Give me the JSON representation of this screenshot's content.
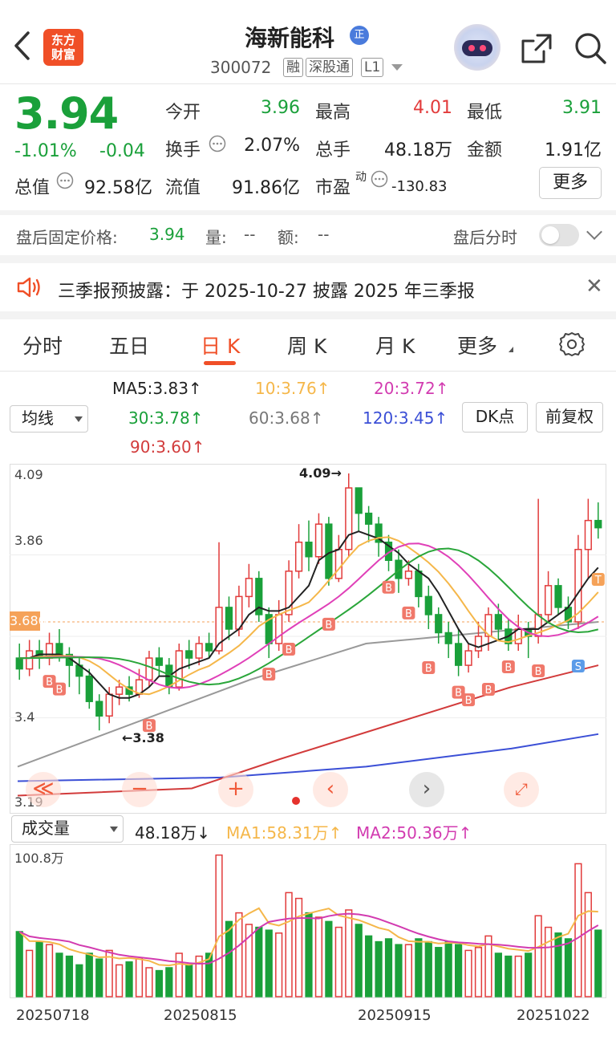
{
  "header": {
    "app_logo": "东方\n财富",
    "stock_name": "海新能科",
    "badge": "正",
    "code": "300072",
    "tags": [
      "融",
      "深股通",
      "L1"
    ]
  },
  "quote": {
    "price": "3.94",
    "change_pct": "-1.01%",
    "change_abs": "-0.04",
    "open_label": "今开",
    "open": "3.96",
    "high_label": "最高",
    "high": "4.01",
    "low_label": "最低",
    "low": "3.91",
    "turnover_label": "换手",
    "turnover": "2.07%",
    "volume_label": "总手",
    "volume": "48.18万",
    "amount_label": "金额",
    "amount": "1.91亿",
    "mktcap_label": "总值",
    "mktcap": "92.58亿",
    "float_label": "流值",
    "float": "91.86亿",
    "pe_label": "市盈",
    "pe_sup": "动",
    "pe": "-130.83",
    "more": "更多"
  },
  "after_hours": {
    "label": "盘后固定价格:",
    "price": "3.94",
    "vol_label": "量:",
    "vol": "--",
    "amt_label": "额:",
    "amt": "--",
    "timeshare": "盘后分时"
  },
  "notice": {
    "text": "三季报预披露：于 2025-10-27 披露 2025 年三季报"
  },
  "tabs": [
    {
      "label": "分时"
    },
    {
      "label": "五日"
    },
    {
      "label": "日 K"
    },
    {
      "label": "周 K"
    },
    {
      "label": "月 K"
    },
    {
      "label": "更多"
    }
  ],
  "ma_legend": {
    "selector": "均线",
    "ma5": "MA5:3.83↑",
    "ma10": "10:3.76↑",
    "ma20": "20:3.72↑",
    "ma30": "30:3.78↑",
    "ma60": "60:3.68↑",
    "ma120": "120:3.45↑",
    "ma90": "90:3.60↑",
    "dk_button": "DK点",
    "adjust_button": "前复权"
  },
  "kline": {
    "y_max_label": "4.09",
    "y_mid_label": "3.86",
    "y_cur_label": "3.680",
    "y_low_label": "3.4",
    "y_min_label": "3.19",
    "high_marker": "4.09→",
    "low_marker": "←3.38",
    "colors": {
      "up": "#e23b3b",
      "down": "#1aa03a",
      "ma5": "#222222",
      "ma10": "#f5b74a",
      "ma20": "#e040b8",
      "ma30": "#2aa63a",
      "ma60": "#999999",
      "ma120": "#3b4fd6",
      "ma90": "#d23b3b"
    },
    "controls": [
      "fast-back-icon",
      "zoom-out-icon",
      "zoom-in-icon",
      "prev-icon",
      "next-icon",
      "fullscreen-icon"
    ]
  },
  "volume_panel": {
    "selector": "成交量",
    "vol": "48.18万↓",
    "ma1": "MA1:58.31万↑",
    "ma2": "MA2:50.36万↑",
    "y_max_label": "100.8万"
  },
  "dates": [
    "20250718",
    "20250815",
    "20250915",
    "20251022"
  ],
  "chart_data": {
    "type": "candlestick",
    "ylim": [
      3.19,
      4.09
    ],
    "candles": [
      [
        3.58,
        3.55,
        3.62,
        3.52
      ],
      [
        3.55,
        3.6,
        3.63,
        3.53
      ],
      [
        3.6,
        3.58,
        3.63,
        3.55
      ],
      [
        3.58,
        3.62,
        3.65,
        3.56
      ],
      [
        3.62,
        3.59,
        3.66,
        3.57
      ],
      [
        3.59,
        3.56,
        3.61,
        3.5
      ],
      [
        3.56,
        3.53,
        3.58,
        3.48
      ],
      [
        3.53,
        3.46,
        3.55,
        3.44
      ],
      [
        3.46,
        3.42,
        3.48,
        3.38
      ],
      [
        3.42,
        3.48,
        3.5,
        3.4
      ],
      [
        3.48,
        3.5,
        3.52,
        3.45
      ],
      [
        3.5,
        3.48,
        3.53,
        3.46
      ],
      [
        3.48,
        3.52,
        3.55,
        3.47
      ],
      [
        3.52,
        3.58,
        3.6,
        3.5
      ],
      [
        3.58,
        3.56,
        3.61,
        3.53
      ],
      [
        3.56,
        3.5,
        3.58,
        3.48
      ],
      [
        3.5,
        3.6,
        3.62,
        3.49
      ],
      [
        3.6,
        3.58,
        3.63,
        3.55
      ],
      [
        3.58,
        3.62,
        3.64,
        3.56
      ],
      [
        3.62,
        3.6,
        3.65,
        3.58
      ],
      [
        3.6,
        3.72,
        3.9,
        3.59
      ],
      [
        3.72,
        3.66,
        3.75,
        3.63
      ],
      [
        3.66,
        3.75,
        3.78,
        3.64
      ],
      [
        3.75,
        3.8,
        3.84,
        3.72
      ],
      [
        3.8,
        3.7,
        3.82,
        3.68
      ],
      [
        3.7,
        3.62,
        3.72,
        3.58
      ],
      [
        3.62,
        3.7,
        3.74,
        3.6
      ],
      [
        3.7,
        3.82,
        3.85,
        3.68
      ],
      [
        3.82,
        3.9,
        3.95,
        3.8
      ],
      [
        3.9,
        3.86,
        3.96,
        3.82
      ],
      [
        3.86,
        3.95,
        3.98,
        3.84
      ],
      [
        3.95,
        3.8,
        3.97,
        3.78
      ],
      [
        3.8,
        3.88,
        3.92,
        3.79
      ],
      [
        3.88,
        4.05,
        4.09,
        3.86
      ],
      [
        4.05,
        3.98,
        4.03,
        3.93
      ],
      [
        3.98,
        3.95,
        4.0,
        3.9
      ],
      [
        3.95,
        3.9,
        3.97,
        3.86
      ],
      [
        3.9,
        3.85,
        3.92,
        3.82
      ],
      [
        3.85,
        3.8,
        3.88,
        3.76
      ],
      [
        3.8,
        3.82,
        3.85,
        3.78
      ],
      [
        3.82,
        3.75,
        3.84,
        3.72
      ],
      [
        3.75,
        3.7,
        3.78,
        3.66
      ],
      [
        3.7,
        3.65,
        3.72,
        3.62
      ],
      [
        3.65,
        3.62,
        3.68,
        3.58
      ],
      [
        3.62,
        3.56,
        3.66,
        3.53
      ],
      [
        3.56,
        3.6,
        3.62,
        3.54
      ],
      [
        3.6,
        3.64,
        3.68,
        3.58
      ],
      [
        3.64,
        3.7,
        3.72,
        3.6
      ],
      [
        3.7,
        3.66,
        3.73,
        3.63
      ],
      [
        3.66,
        3.62,
        3.69,
        3.6
      ],
      [
        3.62,
        3.66,
        3.7,
        3.6
      ],
      [
        3.66,
        3.64,
        3.68,
        3.58
      ],
      [
        3.64,
        3.7,
        4.02,
        3.62
      ],
      [
        3.7,
        3.78,
        3.82,
        3.68
      ],
      [
        3.78,
        3.72,
        3.8,
        3.7
      ],
      [
        3.72,
        3.68,
        3.75,
        3.66
      ],
      [
        3.68,
        3.88,
        3.92,
        3.66
      ],
      [
        3.88,
        3.96,
        4.02,
        3.8
      ],
      [
        3.96,
        3.94,
        4.01,
        3.91
      ]
    ],
    "ma5": [
      3.58,
      3.58,
      3.59,
      3.59,
      3.59,
      3.58,
      3.56,
      3.54,
      3.51,
      3.48,
      3.47,
      3.47,
      3.48,
      3.5,
      3.53,
      3.53,
      3.55,
      3.56,
      3.57,
      3.58,
      3.62,
      3.64,
      3.66,
      3.7,
      3.72,
      3.71,
      3.71,
      3.72,
      3.75,
      3.78,
      3.85,
      3.87,
      3.88,
      3.92,
      3.93,
      3.92,
      3.91,
      3.89,
      3.87,
      3.84,
      3.82,
      3.8,
      3.76,
      3.71,
      3.66,
      3.62,
      3.61,
      3.62,
      3.63,
      3.64,
      3.66,
      3.66,
      3.66,
      3.68,
      3.7,
      3.72,
      3.76,
      3.8,
      3.83
    ]
  }
}
